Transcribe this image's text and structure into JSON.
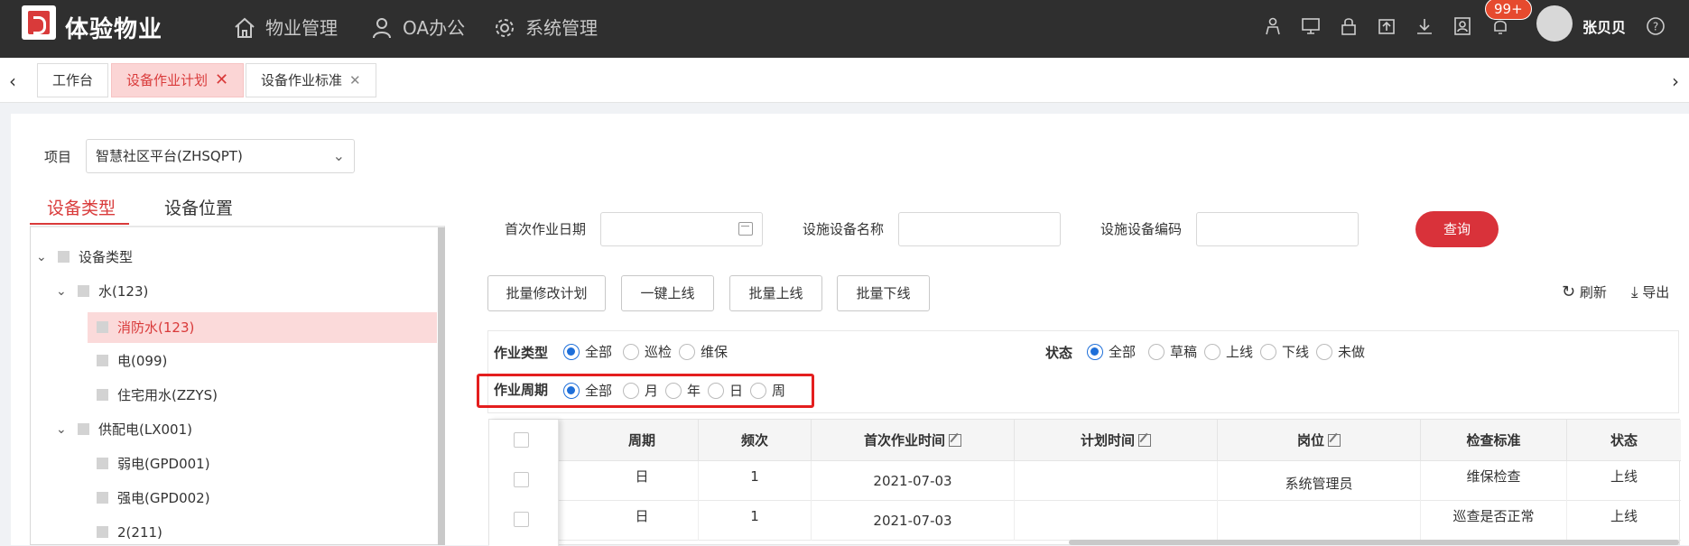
{
  "app": {
    "title": "体验物业"
  },
  "nav": [
    {
      "label": "物业管理",
      "icon": "home-icon"
    },
    {
      "label": "OA办公",
      "icon": "user-icon"
    },
    {
      "label": "系统管理",
      "icon": "gear-icon"
    }
  ],
  "header": {
    "badge": "99+",
    "username": "张贝贝"
  },
  "tabs": [
    {
      "label": "工作台"
    },
    {
      "label": "设备作业计划",
      "close": "✕"
    },
    {
      "label": "设备作业标准",
      "close": "✕"
    }
  ],
  "project": {
    "label": "项目",
    "value": "智慧社区平台(ZHSQPT)"
  },
  "left_tabs": {
    "type": "设备类型",
    "location": "设备位置"
  },
  "tree": [
    {
      "label": "设备类型"
    },
    {
      "label": "水(123)"
    },
    {
      "label": "消防水(123)"
    },
    {
      "label": "电(099)"
    },
    {
      "label": "住宅用水(ZZYS)"
    },
    {
      "label": "供配电(LX001)"
    },
    {
      "label": "弱电(GPD001)"
    },
    {
      "label": "强电(GPD002)"
    },
    {
      "label": "2(211)"
    }
  ],
  "search": {
    "first_date_label": "首次作业日期",
    "name_label": "设施设备名称",
    "code_label": "设施设备编码",
    "query": "查询"
  },
  "buttons": {
    "batch_edit": "批量修改计划",
    "one_online": "一键上线",
    "batch_online": "批量上线",
    "batch_offline": "批量下线",
    "refresh": "刷新",
    "export": "导出"
  },
  "filters": {
    "work_type": {
      "label": "作业类型",
      "options": [
        "全部",
        "巡检",
        "维保"
      ],
      "selected": "全部"
    },
    "status": {
      "label": "状态",
      "options": [
        "全部",
        "草稿",
        "上线",
        "下线",
        "未做"
      ],
      "selected": "全部"
    },
    "cycle": {
      "label": "作业周期",
      "options": [
        "全部",
        "月",
        "年",
        "日",
        "周"
      ],
      "selected": "全部"
    }
  },
  "table": {
    "columns": [
      "周期",
      "频次",
      "首次作业时间",
      "计划时间",
      "岗位",
      "检查标准",
      "状态"
    ],
    "rows": [
      [
        "日",
        "1",
        "2021-07-03",
        "",
        "系统管理员",
        "维保检查",
        "上线"
      ],
      [
        "日",
        "1",
        "2021-07-03",
        "",
        "",
        "巡查是否正常",
        "上线"
      ]
    ]
  }
}
